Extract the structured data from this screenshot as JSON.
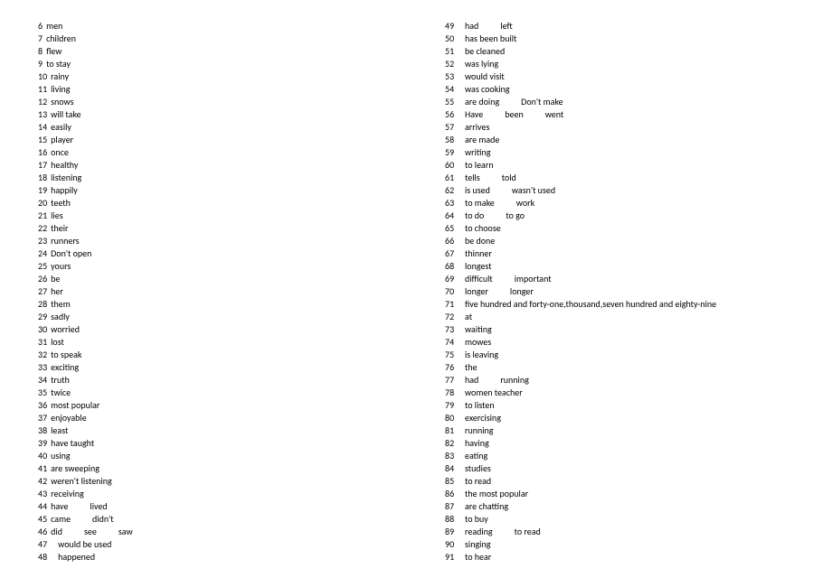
{
  "left": [
    {
      "n": "6",
      "a": [
        "men"
      ]
    },
    {
      "n": "7",
      "a": [
        "children"
      ]
    },
    {
      "n": "8",
      "a": [
        "flew"
      ]
    },
    {
      "n": "9",
      "a": [
        "to stay"
      ]
    },
    {
      "n": "10",
      "a": [
        "rainy"
      ]
    },
    {
      "n": "11",
      "a": [
        "living"
      ]
    },
    {
      "n": "12",
      "a": [
        "snows"
      ]
    },
    {
      "n": "13",
      "a": [
        "will take"
      ]
    },
    {
      "n": "14",
      "a": [
        "easily"
      ]
    },
    {
      "n": "15",
      "a": [
        "player"
      ]
    },
    {
      "n": "16",
      "a": [
        "once"
      ]
    },
    {
      "n": "17",
      "a": [
        "healthy"
      ]
    },
    {
      "n": "18",
      "a": [
        "listening"
      ]
    },
    {
      "n": "19",
      "a": [
        "happily"
      ]
    },
    {
      "n": "20",
      "a": [
        "teeth"
      ]
    },
    {
      "n": "21",
      "a": [
        "lies"
      ]
    },
    {
      "n": "22",
      "a": [
        "their"
      ]
    },
    {
      "n": "23",
      "a": [
        "runners"
      ]
    },
    {
      "n": "24",
      "a": [
        "Don't open"
      ]
    },
    {
      "n": "25",
      "a": [
        "yours"
      ]
    },
    {
      "n": "26",
      "a": [
        "be"
      ]
    },
    {
      "n": "27",
      "a": [
        "her"
      ]
    },
    {
      "n": "28",
      "a": [
        "them"
      ]
    },
    {
      "n": "29",
      "a": [
        "sadly"
      ]
    },
    {
      "n": "30",
      "a": [
        "worried"
      ]
    },
    {
      "n": "31",
      "a": [
        "lost"
      ]
    },
    {
      "n": "32",
      "a": [
        "to speak"
      ]
    },
    {
      "n": "33",
      "a": [
        "exciting"
      ]
    },
    {
      "n": "34",
      "a": [
        "truth"
      ]
    },
    {
      "n": "35",
      "a": [
        "twice"
      ]
    },
    {
      "n": "36",
      "a": [
        "most popular"
      ]
    },
    {
      "n": "37",
      "a": [
        "enjoyable"
      ]
    },
    {
      "n": "38",
      "a": [
        "least"
      ]
    },
    {
      "n": "39",
      "a": [
        "have taught"
      ]
    },
    {
      "n": "40",
      "a": [
        "using"
      ]
    },
    {
      "n": "41",
      "a": [
        "are sweeping"
      ]
    },
    {
      "n": "42",
      "a": [
        "weren't listening"
      ]
    },
    {
      "n": "43",
      "a": [
        "receiving"
      ]
    },
    {
      "n": "44",
      "a": [
        "have",
        "lived"
      ]
    },
    {
      "n": "45",
      "a": [
        "came",
        "didn't"
      ]
    },
    {
      "n": "46",
      "a": [
        "did",
        "see",
        "saw"
      ]
    },
    {
      "n": "47",
      "a": [
        "would be used"
      ],
      "pad": true
    },
    {
      "n": "48",
      "a": [
        "happened"
      ],
      "pad": true
    }
  ],
  "right": [
    {
      "n": "49",
      "a": [
        "had",
        "left"
      ]
    },
    {
      "n": "50",
      "a": [
        "has been built"
      ]
    },
    {
      "n": "51",
      "a": [
        "be cleaned"
      ]
    },
    {
      "n": "52",
      "a": [
        "was lying"
      ]
    },
    {
      "n": "53",
      "a": [
        "would visit"
      ]
    },
    {
      "n": "54",
      "a": [
        "was cooking"
      ]
    },
    {
      "n": "55",
      "a": [
        "are doing",
        "Don't make"
      ]
    },
    {
      "n": "56",
      "a": [
        "Have",
        "been",
        "went"
      ]
    },
    {
      "n": "57",
      "a": [
        "arrives"
      ]
    },
    {
      "n": "58",
      "a": [
        "are made"
      ]
    },
    {
      "n": "59",
      "a": [
        "writing"
      ]
    },
    {
      "n": "60",
      "a": [
        "to learn"
      ]
    },
    {
      "n": "61",
      "a": [
        "tells",
        "told"
      ]
    },
    {
      "n": "62",
      "a": [
        "is used",
        "wasn't used"
      ]
    },
    {
      "n": "63",
      "a": [
        "to make",
        "work"
      ]
    },
    {
      "n": "64",
      "a": [
        "to do",
        "to go"
      ]
    },
    {
      "n": "65",
      "a": [
        "to choose"
      ]
    },
    {
      "n": "66",
      "a": [
        "be done"
      ]
    },
    {
      "n": "67",
      "a": [
        "thinner"
      ]
    },
    {
      "n": "68",
      "a": [
        "longest"
      ]
    },
    {
      "n": "69",
      "a": [
        "difficult",
        "important"
      ]
    },
    {
      "n": "70",
      "a": [
        "longer",
        "longer"
      ]
    },
    {
      "n": "71",
      "a": [
        "five hundred and forty-one,thousand,seven hundred and eighty-nine"
      ]
    },
    {
      "n": "72",
      "a": [
        "at"
      ]
    },
    {
      "n": "73",
      "a": [
        "waiting"
      ]
    },
    {
      "n": "74",
      "a": [
        "mowes"
      ]
    },
    {
      "n": "75",
      "a": [
        "is leaving"
      ]
    },
    {
      "n": "76",
      "a": [
        "the"
      ]
    },
    {
      "n": "77",
      "a": [
        "had",
        "running"
      ]
    },
    {
      "n": "78",
      "a": [
        "women teacher"
      ]
    },
    {
      "n": "79",
      "a": [
        "to listen"
      ]
    },
    {
      "n": "80",
      "a": [
        "exercising"
      ]
    },
    {
      "n": "81",
      "a": [
        "running"
      ]
    },
    {
      "n": "82",
      "a": [
        "having"
      ]
    },
    {
      "n": "83",
      "a": [
        "eating"
      ]
    },
    {
      "n": "84",
      "a": [
        "studies"
      ]
    },
    {
      "n": "85",
      "a": [
        "to read"
      ]
    },
    {
      "n": "86",
      "a": [
        "the most popular"
      ]
    },
    {
      "n": "87",
      "a": [
        "are chatting"
      ]
    },
    {
      "n": "88",
      "a": [
        "to buy"
      ]
    },
    {
      "n": "89",
      "a": [
        "reading",
        "to read"
      ]
    },
    {
      "n": "90",
      "a": [
        "singing"
      ]
    },
    {
      "n": "91",
      "a": [
        "to hear"
      ]
    }
  ]
}
